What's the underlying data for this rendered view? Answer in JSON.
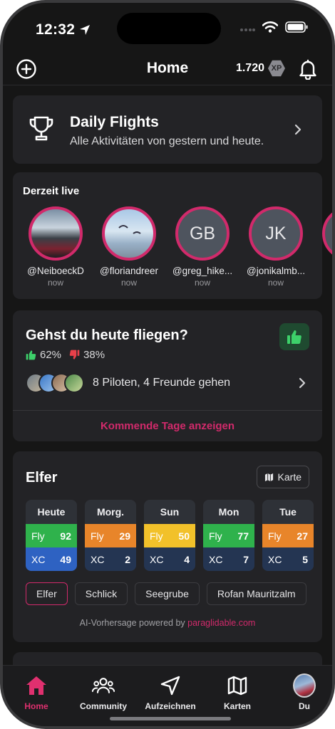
{
  "status_bar": {
    "time": "12:32"
  },
  "nav": {
    "title": "Home",
    "xp_value": "1.720",
    "xp_badge": "XP"
  },
  "daily_flights": {
    "title": "Daily Flights",
    "subtitle": "Alle Aktivitäten von gestern und heute."
  },
  "live": {
    "title": "Derzeit live",
    "items": [
      {
        "handle": "@NeiboeckD",
        "time": "now",
        "initials": ""
      },
      {
        "handle": "@floriandreer",
        "time": "now",
        "initials": ""
      },
      {
        "handle": "@greg_hike...",
        "time": "now",
        "initials": "GB"
      },
      {
        "handle": "@jonikalmb...",
        "time": "now",
        "initials": "JK"
      }
    ]
  },
  "going": {
    "title": "Gehst du heute fliegen?",
    "yes_pct": "62%",
    "no_pct": "38%",
    "pilots_text": "8 Piloten, 4 Freunde gehen",
    "upcoming_link": "Kommende Tage anzeigen"
  },
  "elfer": {
    "title": "Elfer",
    "map_button": "Karte",
    "days": [
      {
        "name": "Heute",
        "fly_label": "Fly",
        "fly": "92",
        "xc_label": "XC",
        "xc": "49",
        "fly_color": "#2fb24c",
        "xc_color": "#2e62c2"
      },
      {
        "name": "Morg.",
        "fly_label": "Fly",
        "fly": "29",
        "xc_label": "XC",
        "xc": "2",
        "fly_color": "#e8852a",
        "xc_color": "#243552"
      },
      {
        "name": "Sun",
        "fly_label": "Fly",
        "fly": "50",
        "xc_label": "XC",
        "xc": "4",
        "fly_color": "#f2c12a",
        "xc_color": "#243552"
      },
      {
        "name": "Mon",
        "fly_label": "Fly",
        "fly": "77",
        "xc_label": "XC",
        "xc": "7",
        "fly_color": "#2fb24c",
        "xc_color": "#243552"
      },
      {
        "name": "Tue",
        "fly_label": "Fly",
        "fly": "27",
        "xc_label": "XC",
        "xc": "5",
        "fly_color": "#e8852a",
        "xc_color": "#243552"
      }
    ],
    "spots": [
      "Elfer",
      "Schlick",
      "Seegrube",
      "Rofan Mauritzalm"
    ],
    "ai_prefix": "AI-Vorhersage powered by",
    "ai_link": "paraglidable.com"
  },
  "tab_bar": {
    "items": [
      {
        "label": "Home",
        "icon": "home-icon"
      },
      {
        "label": "Community",
        "icon": "people-icon"
      },
      {
        "label": "Aufzeichnen",
        "icon": "navigation-arrow-icon"
      },
      {
        "label": "Karten",
        "icon": "map-icon"
      },
      {
        "label": "Du",
        "icon": "profile-avatar"
      }
    ]
  },
  "colors": {
    "accent": "#d12a6b",
    "background": "#161616",
    "card": "#232326"
  }
}
